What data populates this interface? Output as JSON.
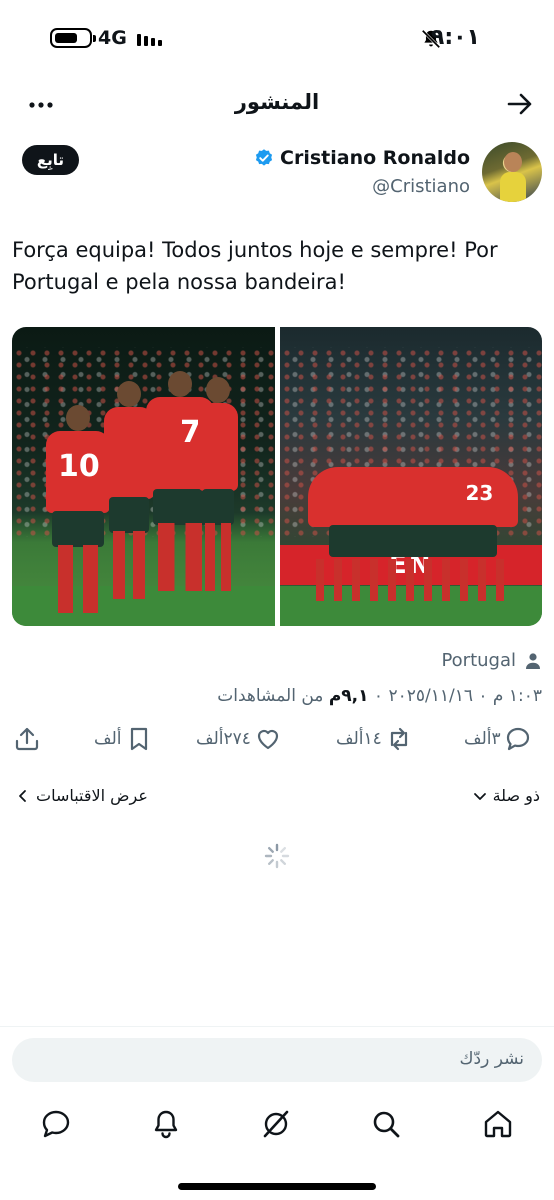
{
  "status_bar": {
    "time": "٩:٠١",
    "network": "4G"
  },
  "header": {
    "title": "المنشور"
  },
  "author": {
    "name": "Cristiano Ronaldo",
    "handle": "@Cristiano",
    "verified": true,
    "follow_label": "تابِع"
  },
  "tweet": {
    "text": "Força equipa! Todos juntos hoje e sempre! Por Portugal e pela nossa bandeira!",
    "banner_text": "EN",
    "jersey_numbers": [
      "10",
      "7",
      "23"
    ]
  },
  "meta": {
    "location": "Portugal",
    "timestamp": "١:٠٣ م ٠ ٢٠٢٥/١١/١٦ ٠",
    "views_count": "٩,١م",
    "views_label": "من المشاهدات"
  },
  "actions": {
    "replies": "٣ألف",
    "reposts": "١٤ألف",
    "likes": "٢٧٤ألف",
    "bookmarks": "ألف"
  },
  "links": {
    "view_quotes": "عرض الاقتباسات",
    "relevant": "ذو صلة"
  },
  "reply": {
    "placeholder": "نشر ردّك"
  },
  "colors": {
    "accent": "#1d9bf0",
    "text": "#0f1419",
    "secondary": "#536471"
  }
}
